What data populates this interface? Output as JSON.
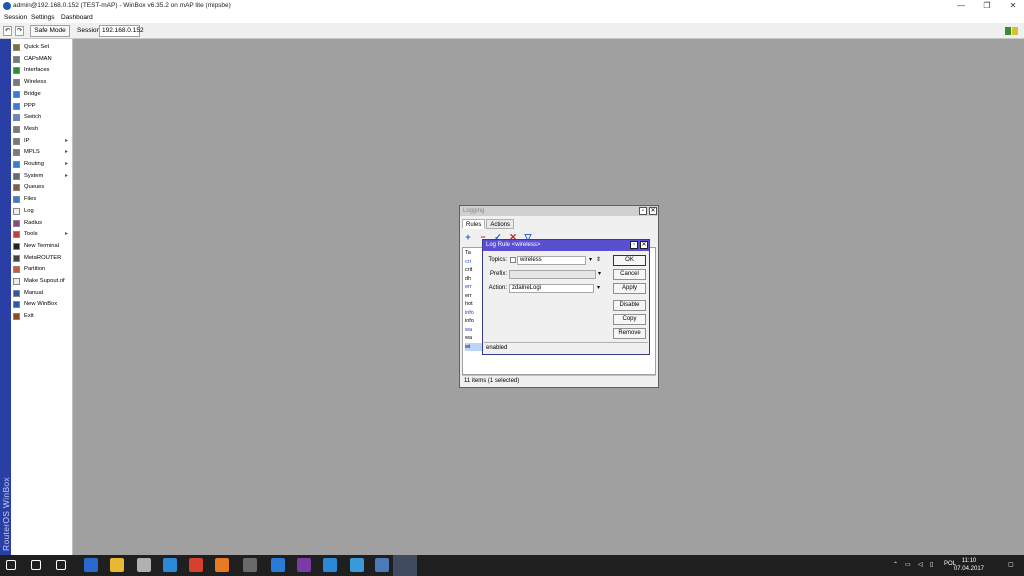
{
  "window": {
    "title": "admin@192.168.0.152 (TEST-mAP) - WinBox v6.35.2 on mAP lite (mipsbe)",
    "minimize": "—",
    "maximize": "❐",
    "close": "✕"
  },
  "menu": [
    "Session",
    "Settings",
    "Dashboard"
  ],
  "toolbar": {
    "undo": "↶",
    "redo": "↷",
    "safe_mode": "Safe Mode",
    "session_label": "Session:",
    "session_value": "192.168.0.152"
  },
  "sidestrip_text": "RouterOS WinBox",
  "sidebar": [
    {
      "label": "Quick Set",
      "icon": "quickset-icon",
      "color": "#8a6a3a",
      "arrow": false
    },
    {
      "label": "CAPsMAN",
      "icon": "capsman-icon",
      "color": "#7a7a7a",
      "arrow": false
    },
    {
      "label": "Interfaces",
      "icon": "interfaces-icon",
      "color": "#2e8b2e",
      "arrow": false
    },
    {
      "label": "Wireless",
      "icon": "wireless-icon",
      "color": "#7a7a7a",
      "arrow": false
    },
    {
      "label": "Bridge",
      "icon": "bridge-icon",
      "color": "#3a7bd5",
      "arrow": false
    },
    {
      "label": "PPP",
      "icon": "ppp-icon",
      "color": "#3a7bd5",
      "arrow": false
    },
    {
      "label": "Switch",
      "icon": "switch-icon",
      "color": "#5a8ad5",
      "arrow": false
    },
    {
      "label": "Mesh",
      "icon": "mesh-icon",
      "color": "#7a7a7a",
      "arrow": false
    },
    {
      "label": "IP",
      "icon": "ip-icon",
      "color": "#7a7a7a",
      "arrow": true
    },
    {
      "label": "MPLS",
      "icon": "mpls-icon",
      "color": "#7a7a7a",
      "arrow": true
    },
    {
      "label": "Routing",
      "icon": "routing-icon",
      "color": "#3a7bd5",
      "arrow": true
    },
    {
      "label": "System",
      "icon": "system-icon",
      "color": "#6a6a6a",
      "arrow": true
    },
    {
      "label": "Queues",
      "icon": "queues-icon",
      "color": "#8a5a3a",
      "arrow": false
    },
    {
      "label": "Files",
      "icon": "files-icon",
      "color": "#3a7bd5",
      "arrow": false
    },
    {
      "label": "Log",
      "icon": "log-icon",
      "color": "#eeeeee",
      "arrow": false
    },
    {
      "label": "Radius",
      "icon": "radius-icon",
      "color": "#8a4a8a",
      "arrow": false
    },
    {
      "label": "Tools",
      "icon": "tools-icon",
      "color": "#c04040",
      "arrow": true
    },
    {
      "label": "New Terminal",
      "icon": "terminal-icon",
      "color": "#222222",
      "arrow": false
    },
    {
      "label": "MetaROUTER",
      "icon": "metarouter-icon",
      "color": "#444444",
      "arrow": false
    },
    {
      "label": "Partition",
      "icon": "partition-icon",
      "color": "#d05a2a",
      "arrow": false
    },
    {
      "label": "Make Supout.rif",
      "icon": "supout-icon",
      "color": "#eeeeee",
      "arrow": false
    },
    {
      "label": "Manual",
      "icon": "manual-icon",
      "color": "#2a5aa8",
      "arrow": false
    },
    {
      "label": "New WinBox",
      "icon": "winbox-icon",
      "color": "#2a5aa8",
      "arrow": false
    },
    {
      "label": "Exit",
      "icon": "exit-icon",
      "color": "#8a4a2a",
      "arrow": false
    }
  ],
  "logging": {
    "title": "Logging",
    "tabs": [
      "Rules",
      "Actions"
    ],
    "tools": [
      {
        "glyph": "+",
        "color": "#1a5ac8",
        "icon": "add-icon"
      },
      {
        "glyph": "−",
        "color": "#c02020",
        "icon": "remove-icon"
      },
      {
        "glyph": "✓",
        "color": "#1a5ac8",
        "icon": "enable-icon"
      },
      {
        "glyph": "✕",
        "color": "#c02020",
        "icon": "disable-icon"
      },
      {
        "glyph": "▽",
        "color": "#1a5ac8",
        "icon": "filter-icon"
      }
    ],
    "rows": [
      {
        "text": "Ta",
        "color": "#000"
      },
      {
        "text": "cri",
        "color": "#1a3acc"
      },
      {
        "text": "crit",
        "color": "#000"
      },
      {
        "text": "dh",
        "color": "#000"
      },
      {
        "text": "err",
        "color": "#1a3acc"
      },
      {
        "text": "err",
        "color": "#000"
      },
      {
        "text": "hot",
        "color": "#000"
      },
      {
        "text": "info",
        "color": "#1a3acc"
      },
      {
        "text": "info",
        "color": "#000"
      },
      {
        "text": "wa",
        "color": "#1a3acc"
      },
      {
        "text": "wa",
        "color": "#000"
      },
      {
        "text": "wi",
        "color": "#000"
      }
    ],
    "status": "11 items (1 selected)"
  },
  "rule": {
    "title": "Log Rule <wireless>",
    "topics_label": "Topics:",
    "topics_value": "wireless",
    "prefix_label": "Prefix:",
    "prefix_value": "",
    "action_label": "Action:",
    "action_value": "zdalneLogi",
    "buttons": [
      "OK",
      "Cancel",
      "Apply",
      "Disable",
      "Copy",
      "Remove"
    ],
    "status": "enabled"
  },
  "taskbar": {
    "icons": [
      {
        "name": "start-icon",
        "color": "#ffffff"
      },
      {
        "name": "search-icon",
        "color": "#ffffff"
      },
      {
        "name": "taskview-icon",
        "color": "#ffffff"
      },
      {
        "name": "app-save-icon",
        "color": "#2a6ad0"
      },
      {
        "name": "explorer-icon",
        "color": "#e8b830"
      },
      {
        "name": "app-tool-icon",
        "color": "#b0b0b0"
      },
      {
        "name": "edge-icon",
        "color": "#2a8ad8"
      },
      {
        "name": "chrome-icon",
        "color": "#d84030"
      },
      {
        "name": "firefox-icon",
        "color": "#e87a20"
      },
      {
        "name": "app-pen-icon",
        "color": "#6a6a6a"
      },
      {
        "name": "app-blue-icon",
        "color": "#2a7ad8"
      },
      {
        "name": "visualstudio-icon",
        "color": "#7a3aa8"
      },
      {
        "name": "ie-icon",
        "color": "#2a8ad8"
      },
      {
        "name": "app-display-icon",
        "color": "#3a9ad8"
      },
      {
        "name": "winbox-task-icon",
        "color": "#4a7ab8"
      }
    ],
    "lang": "POL",
    "time": "11:10",
    "date": "07.04.2017"
  }
}
